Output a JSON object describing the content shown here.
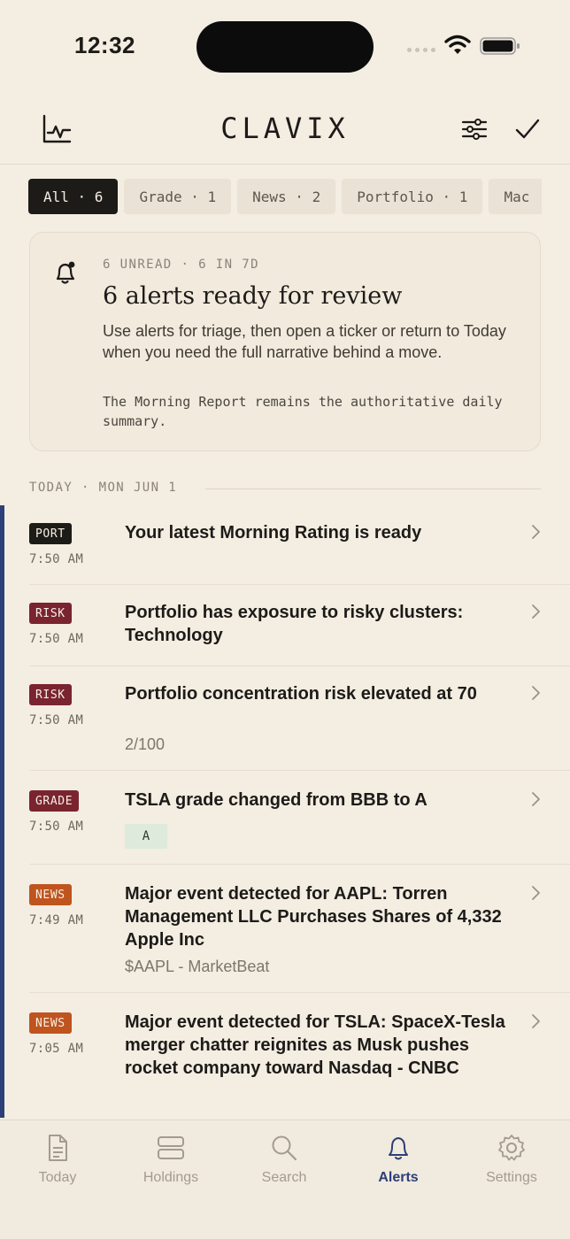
{
  "status_bar": {
    "time": "12:32"
  },
  "header": {
    "title": "CLAVIX"
  },
  "filters": [
    {
      "label": "All · 6",
      "active": true
    },
    {
      "label": "Grade · 1",
      "active": false
    },
    {
      "label": "News · 2",
      "active": false
    },
    {
      "label": "Portfolio · 1",
      "active": false
    },
    {
      "label": "Mac",
      "active": false
    }
  ],
  "summary": {
    "meta": "6 UNREAD · 6 IN 7D",
    "title": "6 alerts ready for review",
    "body": "Use alerts for triage, then open a ticker or return to Today when you need the full narrative behind a move.",
    "note": "The Morning Report remains the authoritative daily summary."
  },
  "section": {
    "label": "TODAY · MON JUN 1"
  },
  "alerts": [
    {
      "tag": "PORT",
      "time": "7:50 AM",
      "title": "Your latest Morning Rating is ready"
    },
    {
      "tag": "RISK",
      "time": "7:50 AM",
      "title": "Portfolio has exposure to risky clusters: Technology"
    },
    {
      "tag": "RISK",
      "time": "7:50 AM",
      "title": "Portfolio concentration risk elevated at 70",
      "subtitle": "2/100"
    },
    {
      "tag": "GRADE",
      "time": "7:50 AM",
      "title": "TSLA grade changed from BBB to A",
      "badge": "A"
    },
    {
      "tag": "NEWS",
      "time": "7:49 AM",
      "title": "Major event detected for AAPL: Torren Management LLC Purchases Shares of 4,332 Apple Inc",
      "subtitle": "$AAPL - MarketBeat"
    },
    {
      "tag": "NEWS",
      "time": "7:05 AM",
      "title": "Major event detected for TSLA: SpaceX-Tesla merger chatter reignites as Musk pushes rocket company toward Nasdaq - CNBC"
    }
  ],
  "tabs": [
    {
      "label": "Today",
      "icon": "document-icon",
      "active": false
    },
    {
      "label": "Holdings",
      "icon": "holdings-icon",
      "active": false
    },
    {
      "label": "Search",
      "icon": "search-icon",
      "active": false
    },
    {
      "label": "Alerts",
      "icon": "bell-icon",
      "active": true
    },
    {
      "label": "Settings",
      "icon": "gear-icon",
      "active": false
    }
  ],
  "colors": {
    "background": "#f3ede2",
    "accent": "#2c3f78",
    "risk": "#7a2430",
    "news": "#c0541f",
    "port": "#1d1b18"
  }
}
